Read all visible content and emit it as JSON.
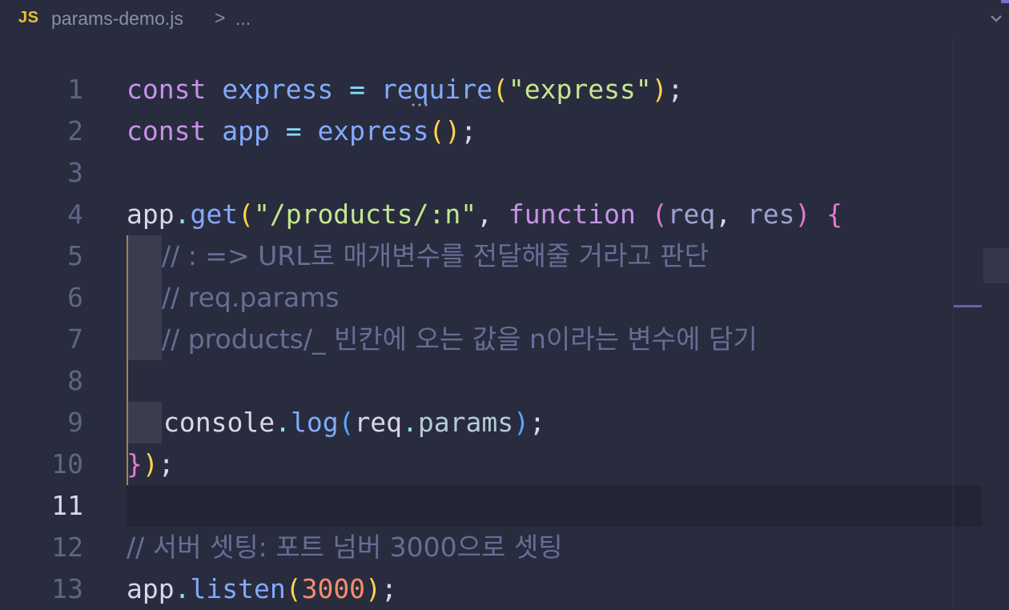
{
  "breadcrumb": {
    "language_badge": "JS",
    "file_name": "params-demo.js",
    "separator": ">",
    "more": "..."
  },
  "colors": {
    "background": "#292c3e",
    "keyword": "#c792ea",
    "function": "#82aaff",
    "string": "#c3e88d",
    "comment": "#676e95",
    "number": "#f78c6c",
    "js_badge": "#e5c229"
  },
  "editor": {
    "active_line": 11,
    "line_numbers": [
      "1",
      "2",
      "3",
      "4",
      "5",
      "6",
      "7",
      "8",
      "9",
      "10",
      "11",
      "12",
      "13"
    ],
    "lines": {
      "l1": {
        "t1": "const",
        "t2": " express ",
        "t3": "=",
        "t4": " ",
        "t5": "require",
        "t6": "(",
        "t7": "\"express\"",
        "t8": ")",
        "t9": ";"
      },
      "l2": {
        "t1": "const",
        "t2": " app ",
        "t3": "=",
        "t4": " ",
        "t5": "express",
        "t6": "(",
        "t7": ")",
        "t8": ";"
      },
      "l4": {
        "t1": "app",
        "t2": ".",
        "t3": "get",
        "t4": "(",
        "t5": "\"/products/:n\"",
        "t6": ", ",
        "t7": "function",
        "t8": " ",
        "t9": "(",
        "t10": "req",
        "t11": ", ",
        "t12": "res",
        "t13": ")",
        "t14": " ",
        "t15": "{"
      },
      "l5": {
        "t1": "// : => URL로 매개변수를 전달해줄 거라고 판단"
      },
      "l6": {
        "t1": "// req.params"
      },
      "l7": {
        "t1": "// products/_ 빈칸에 오는 값을 n이라는 변수에 담기"
      },
      "l9": {
        "t1": "console",
        "t2": ".",
        "t3": "log",
        "t4": "(",
        "t5": "req",
        "t6": ".",
        "t7": "params",
        "t8": ")",
        "t9": ";"
      },
      "l10": {
        "t1": "}",
        "t2": ")",
        "t3": ";"
      },
      "l12": {
        "t1": "// 서버 셋팅: 포트 넘버 3000으로 셋팅"
      },
      "l13": {
        "t1": "app",
        "t2": ".",
        "t3": "listen",
        "t4": "(",
        "t5": "3000",
        "t6": ")",
        "t7": ";"
      }
    }
  }
}
